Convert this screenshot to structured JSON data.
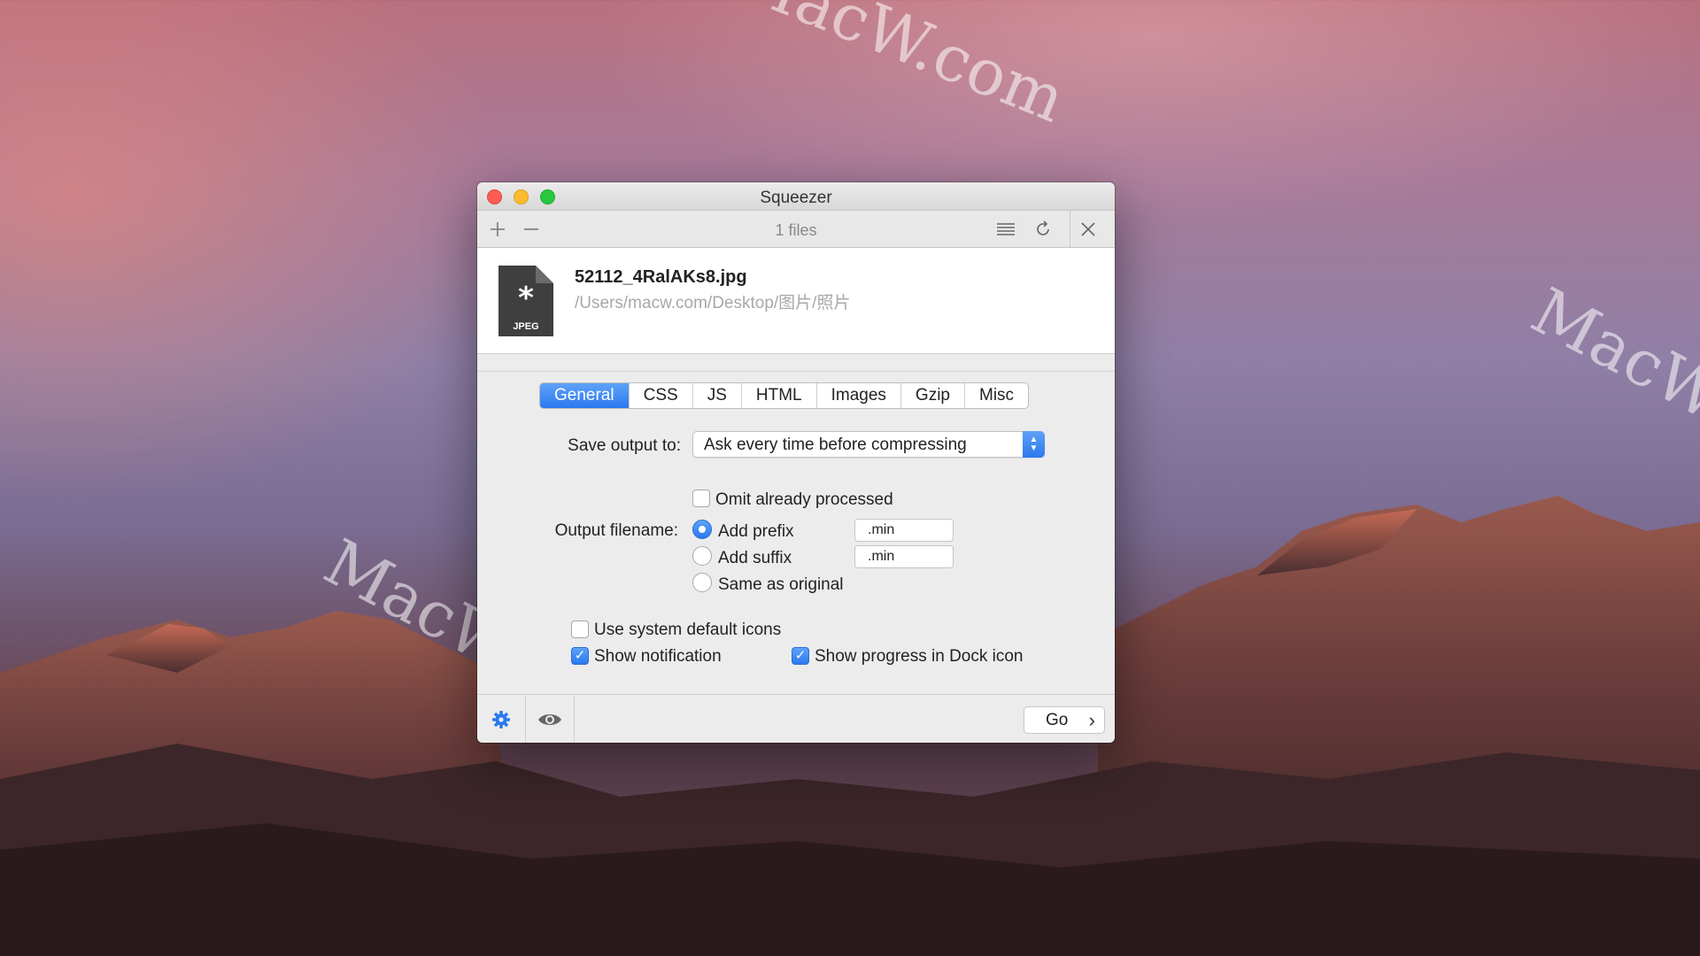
{
  "window": {
    "title": "Squeezer"
  },
  "toolbar": {
    "add_icon": "plus-icon",
    "remove_icon": "minus-icon",
    "file_count": "1 files",
    "list_icon": "list-icon",
    "refresh_icon": "refresh-icon",
    "close_icon": "close-icon"
  },
  "file": {
    "name": "52112_4RalAKs8.jpg",
    "path": "/Users/macw.com/Desktop/图片/照片",
    "icon_label": "JPEG",
    "icon_glyph": "*"
  },
  "tabs": [
    {
      "label": "General",
      "active": true
    },
    {
      "label": "CSS"
    },
    {
      "label": "JS"
    },
    {
      "label": "HTML"
    },
    {
      "label": "Images"
    },
    {
      "label": "Gzip"
    },
    {
      "label": "Misc"
    }
  ],
  "general": {
    "save_output_label": "Save output to:",
    "save_output_value": "Ask every time before compressing",
    "omit_processed": {
      "label": "Omit already processed",
      "checked": false
    },
    "output_filename_label": "Output filename:",
    "filename_options": [
      {
        "label": "Add prefix",
        "selected": true,
        "field": ".min"
      },
      {
        "label": "Add suffix",
        "selected": false,
        "field": ".min"
      },
      {
        "label": "Same as original",
        "selected": false
      }
    ],
    "use_system_icons": {
      "label": "Use system default icons",
      "checked": false
    },
    "show_notification": {
      "label": "Show notification",
      "checked": true
    },
    "show_progress_dock": {
      "label": "Show progress in Dock icon",
      "checked": true
    }
  },
  "bottombar": {
    "settings_icon": "gear-icon",
    "preview_icon": "eye-icon",
    "go_label": "Go"
  },
  "desktop": {
    "watermarks": [
      "MacW.com",
      "MacW.c",
      "MacW.com"
    ]
  },
  "colors": {
    "accent": "#2a79ee",
    "close": "#fc5d57",
    "minimize": "#fdbc2e",
    "maximize": "#28c840"
  }
}
